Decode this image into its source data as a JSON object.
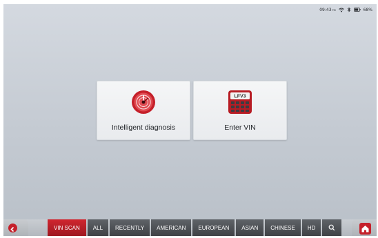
{
  "status_bar": {
    "time": "09:43",
    "ampm": "PM",
    "battery": "68%"
  },
  "cards": {
    "diagnosis_label": "Intelligent diagnosis",
    "vin_label": "Enter VIN",
    "vin_icon_text": "LFV3"
  },
  "tabs": [
    {
      "label": "VIN SCAN",
      "active": true
    },
    {
      "label": "ALL"
    },
    {
      "label": "RECENTLY"
    },
    {
      "label": "AMERICAN"
    },
    {
      "label": "EUROPEAN"
    },
    {
      "label": "ASIAN"
    },
    {
      "label": "CHINESE"
    },
    {
      "label": "HD"
    }
  ],
  "icons": {
    "back": "back-arrow-icon",
    "home": "home-icon",
    "search": "search-icon",
    "wifi": "wifi-icon",
    "bluetooth": "bluetooth-icon",
    "battery": "battery-icon",
    "diagnosis": "gauge-icon",
    "vin": "vin-keypad-icon"
  },
  "colors": {
    "accent": "#c5202a",
    "tab_bg": "#4a4d52"
  }
}
